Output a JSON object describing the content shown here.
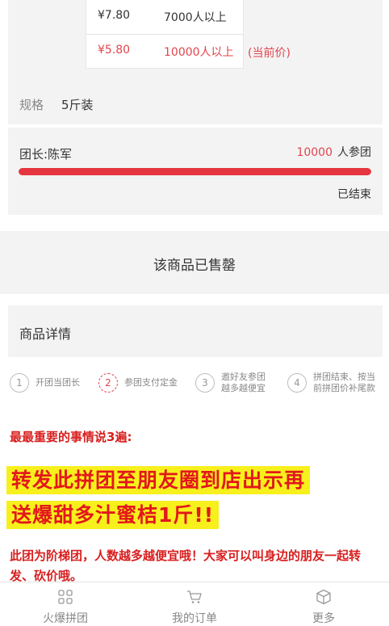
{
  "price_tiers": [
    {
      "price": "¥7.80",
      "people": "7000人以上"
    },
    {
      "price": "¥5.80",
      "people": "10000人以上",
      "tag": "(当前价)"
    }
  ],
  "spec": {
    "label": "规格",
    "value": "5斤装"
  },
  "group": {
    "leader": "团长:陈军",
    "count": "10000",
    "count_unit": "人参团",
    "progress": 1.0,
    "status": "已结束"
  },
  "soldout_text": "该商品已售罄",
  "detail_title": "商品详情",
  "steps": [
    {
      "num": "1",
      "lines": [
        "开团当团长"
      ]
    },
    {
      "num": "2",
      "lines": [
        "参团支付定金"
      ]
    },
    {
      "num": "3",
      "lines": [
        "邀好友参团",
        "越多越便宜"
      ]
    },
    {
      "num": "4",
      "lines": [
        "拼团结束、按当",
        "前拼团价补尾款"
      ]
    }
  ],
  "promo": {
    "line1": "最最重要的事情说3遍:",
    "highlight1": "转发此拼团至朋友圈到店出示再",
    "highlight2": "送爆甜多汁蜜桔1斤!!",
    "line3": "此团为阶梯团，人数越多越便宜哦！大家可以叫身边的朋友一起转发、砍价哦。"
  },
  "tabs": [
    {
      "label": "火爆拼团",
      "icon": "grid-icon"
    },
    {
      "label": "我的订单",
      "icon": "cart-icon"
    },
    {
      "label": "更多",
      "icon": "box-icon"
    }
  ],
  "colors": {
    "accent": "#e0454d",
    "highlight": "#f7f01c",
    "promo_red": "#d81e1e"
  }
}
